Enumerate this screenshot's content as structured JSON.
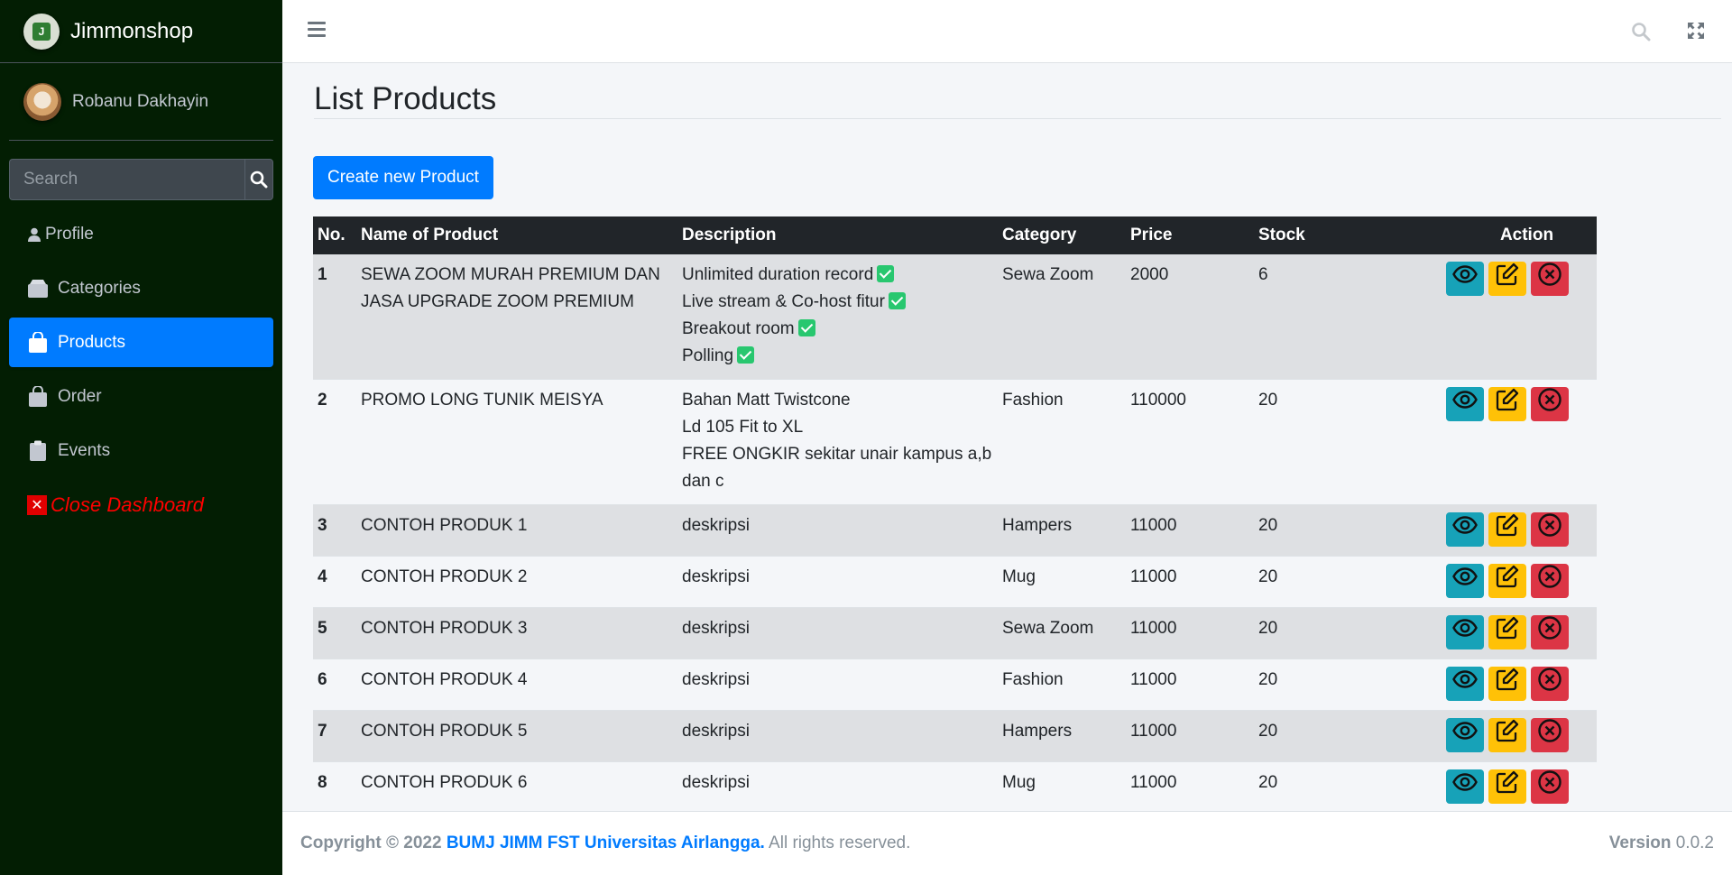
{
  "brand": {
    "name": "Jimmonshop",
    "logo_letter": "J"
  },
  "user": {
    "name": "Robanu Dakhayin"
  },
  "search": {
    "placeholder": "Search"
  },
  "nav": {
    "profile": "Profile",
    "categories": "Categories",
    "products": "Products",
    "order": "Order",
    "events": "Events",
    "close": "Close Dashboard"
  },
  "page": {
    "title": "List Products",
    "create_label": "Create new Product"
  },
  "table": {
    "headers": [
      "No.",
      "Name of Product",
      "Description",
      "Category",
      "Price",
      "Stock",
      "Action"
    ],
    "rows": [
      {
        "no": "1",
        "name": "SEWA ZOOM MURAH PREMIUM DAN JASA UPGRADE ZOOM PREMIUM",
        "desc": [
          "Unlimited duration record",
          "Live stream & Co-host fitur",
          "Breakout room",
          "Polling"
        ],
        "category": "Sewa Zoom",
        "price": "2000",
        "stock": "6"
      },
      {
        "no": "2",
        "name": "PROMO LONG TUNIK MEISYA",
        "desc": [
          "Bahan Matt Twistcone",
          "Ld 105 Fit to XL",
          "FREE ONGKIR sekitar unair kampus a,b dan c"
        ],
        "category": "Fashion",
        "price": "110000",
        "stock": "20"
      },
      {
        "no": "3",
        "name": "CONTOH PRODUK 1",
        "desc": [
          "deskripsi"
        ],
        "category": "Hampers",
        "price": "11000",
        "stock": "20"
      },
      {
        "no": "4",
        "name": "CONTOH PRODUK 2",
        "desc": [
          "deskripsi"
        ],
        "category": "Mug",
        "price": "11000",
        "stock": "20"
      },
      {
        "no": "5",
        "name": "CONTOH PRODUK 3",
        "desc": [
          "deskripsi"
        ],
        "category": "Sewa Zoom",
        "price": "11000",
        "stock": "20"
      },
      {
        "no": "6",
        "name": "CONTOH PRODUK 4",
        "desc": [
          "deskripsi"
        ],
        "category": "Fashion",
        "price": "11000",
        "stock": "20"
      },
      {
        "no": "7",
        "name": "CONTOH PRODUK 5",
        "desc": [
          "deskripsi"
        ],
        "category": "Hampers",
        "price": "11000",
        "stock": "20"
      },
      {
        "no": "8",
        "name": "CONTOH PRODUK 6",
        "desc": [
          "deskripsi"
        ],
        "category": "Mug",
        "price": "11000",
        "stock": "20"
      }
    ]
  },
  "footer": {
    "copyright": "Copyright © 2022",
    "org": "BUMJ JIMM FST Universitas Airlangga.",
    "rights": "All rights reserved.",
    "version_label": "Version",
    "version": "0.0.2"
  },
  "colors": {
    "sidebar": "#031e03",
    "primary": "#007bff",
    "info": "#17a2b8",
    "warning": "#ffc107",
    "danger": "#dc3545",
    "check": "#28c76f"
  }
}
